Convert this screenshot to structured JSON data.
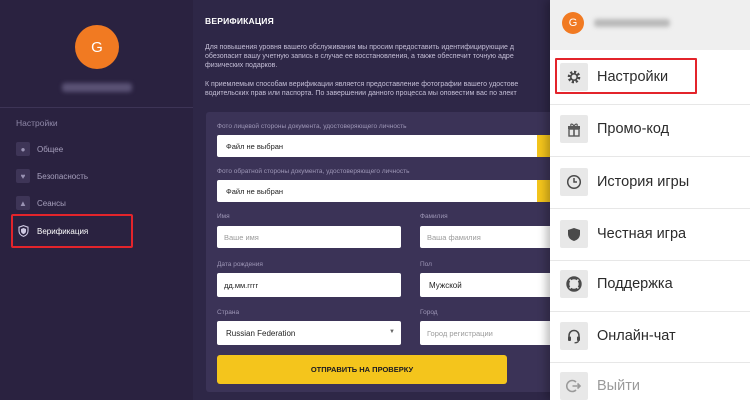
{
  "profile": {
    "initial": "G"
  },
  "sidebar": {
    "heading": "Настройки",
    "items": [
      {
        "label": "Общее",
        "icon": "user-icon"
      },
      {
        "label": "Безопасность",
        "icon": "heart-icon"
      },
      {
        "label": "Сеансы",
        "icon": "sessions-icon"
      },
      {
        "label": "Верификация",
        "icon": "shield-icon"
      }
    ]
  },
  "verification": {
    "title": "ВЕРИФИКАЦИЯ",
    "paragraph1": "Для повышения уровня вашего обслуживания мы просим предоставить идентифицирующие д\nобезопасит вашу учетную запись в случае ее восстановления, а также обеспечит точную адре\nфизических подарков.",
    "paragraph2": "К приемлемым способам верификации является предоставление фотографии вашего удостове\nводительских прав или паспорта. По завершении данного процесса мы оповестим вас по элект",
    "front_label": "Фото лицевой стороны документа, удостоверяющего личность",
    "front_value": "Файл не выбран",
    "back_label": "Фото обратной стороны документа, удостоверяющего личность",
    "back_value": "Файл не выбран",
    "name_label": "Имя",
    "name_placeholder": "Ваше имя",
    "surname_label": "Фамилия",
    "surname_placeholder": "Ваша фамилия",
    "dob_label": "Дата рождения",
    "dob_placeholder": "дд.мм.гггг",
    "gender_label": "Пол",
    "gender_value": "Мужской",
    "country_label": "Страна",
    "country_value": "Russian Federation",
    "city_label": "Город",
    "city_placeholder": "Город регистрации",
    "submit_label": "ОТПРАВИТЬ НА ПРОВЕРКУ"
  },
  "mobile_menu": {
    "initial": "G",
    "items": [
      {
        "label": "Настройки",
        "icon": "gear-icon"
      },
      {
        "label": "Промо-код",
        "icon": "gift-icon"
      },
      {
        "label": "История игры",
        "icon": "clock-icon"
      },
      {
        "label": "Честная игра",
        "icon": "shield-icon"
      },
      {
        "label": "Поддержка",
        "icon": "lifebuoy-icon"
      },
      {
        "label": "Онлайн-чат",
        "icon": "headset-icon"
      },
      {
        "label": "Выйти",
        "icon": "logout-icon"
      }
    ]
  },
  "colors": {
    "accent": "#f4c51c",
    "highlight": "#e3242b",
    "avatar": "#f17a22",
    "dark_bg": "#2e2747"
  }
}
